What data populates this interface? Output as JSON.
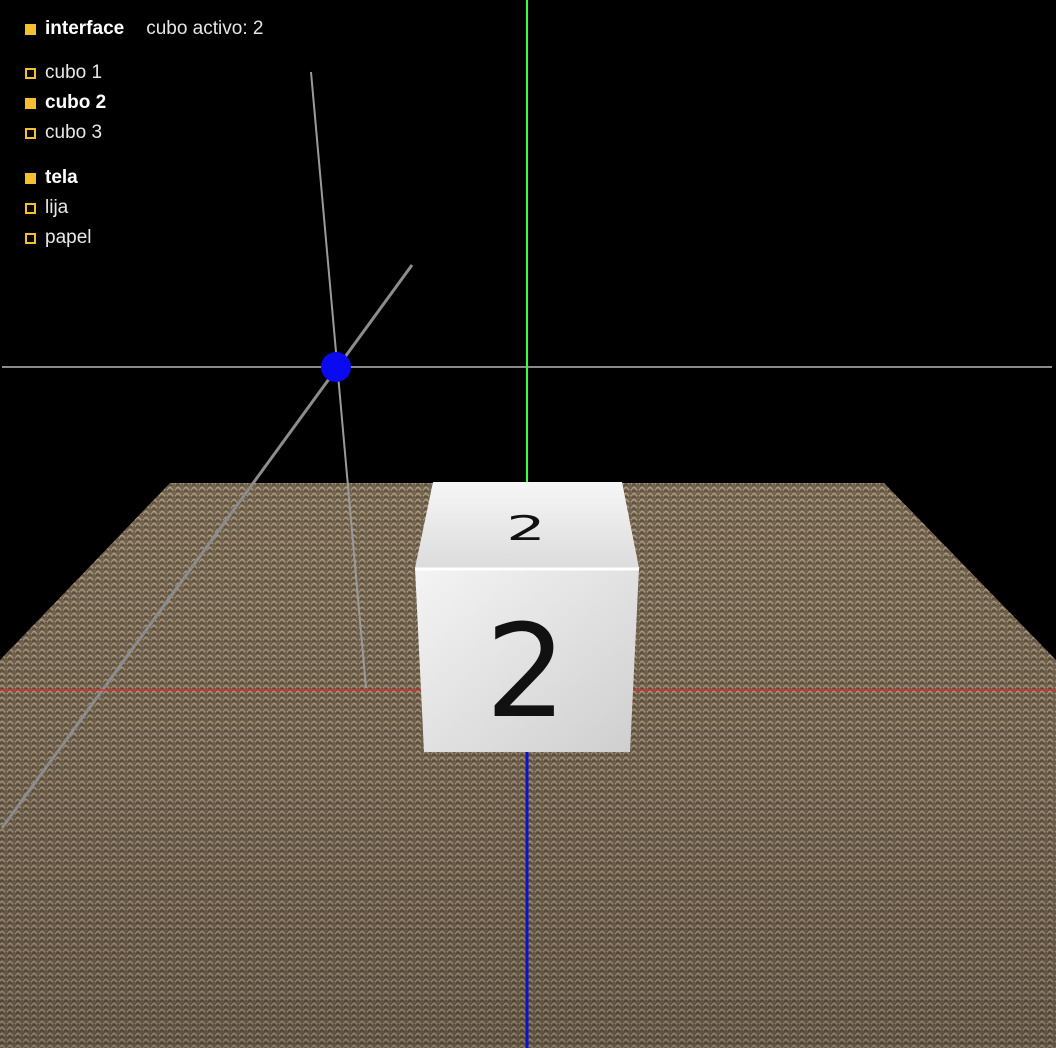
{
  "interface": {
    "title": "interface",
    "title_checked": true,
    "status_text": "cubo activo: 2"
  },
  "cubes": [
    {
      "label": "cubo 1",
      "checked": false
    },
    {
      "label": "cubo 2",
      "checked": true
    },
    {
      "label": "cubo 3",
      "checked": false
    }
  ],
  "materials": [
    {
      "label": "tela",
      "checked": true
    },
    {
      "label": "lija",
      "checked": false
    },
    {
      "label": "papel",
      "checked": false
    }
  ],
  "scene": {
    "active_cube_number": "2",
    "floor_material": "tela",
    "axis_colors": {
      "x": "#e03030",
      "y": "#3cff3c",
      "z": "#1010d0"
    },
    "light_marker_color": "#0a0af0",
    "accent_color": "#f5c02f"
  }
}
